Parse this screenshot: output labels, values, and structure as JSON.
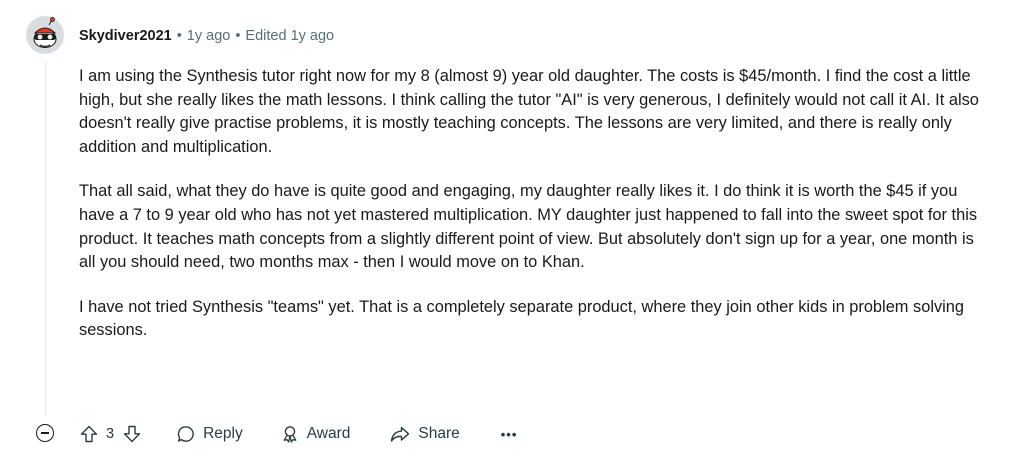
{
  "comment": {
    "author": "Skydiver2021",
    "separator": "•",
    "age": "1y ago",
    "edited": "Edited 1y ago",
    "avatar_icon": "snoo-avatar-with-goggles",
    "paragraphs": [
      "I am using the Synthesis tutor right now for my 8 (almost 9) year old daughter. The costs is $45/month. I find the cost a little high, but she really likes the math lessons. I think calling the tutor \"AI\" is very generous, I definitely would not call it AI. It also doesn't really give practise problems, it is mostly teaching concepts. The lessons are very limited, and there is really only addition and multiplication.",
      "That all said, what they do have is quite good and engaging, my daughter really likes it. I do think it is worth the $45 if you have a 7 to 9 year old who has not yet mastered multiplication. MY daughter just happened to fall into the sweet spot for this product. It teaches math concepts from a slightly different point of view. But absolutely don't sign up for a year, one month is all you should need, two months max - then I would move on to Khan.",
      "I have not tried Synthesis \"teams\" yet. That is a completely separate product, where they join other kids in problem solving sessions."
    ]
  },
  "actions": {
    "collapse_icon": "collapse-minus-icon",
    "upvote_icon": "upvote-arrow-icon",
    "vote_count": "3",
    "downvote_icon": "downvote-arrow-icon",
    "reply_label": "Reply",
    "award_label": "Award",
    "share_label": "Share",
    "more_label": "•••"
  },
  "colors": {
    "text": "#1a1a1b",
    "meta": "#576f76",
    "action": "#2a3c42",
    "avatar_bg": "#d9dde0",
    "avatar_accent": "#e23b2a"
  }
}
